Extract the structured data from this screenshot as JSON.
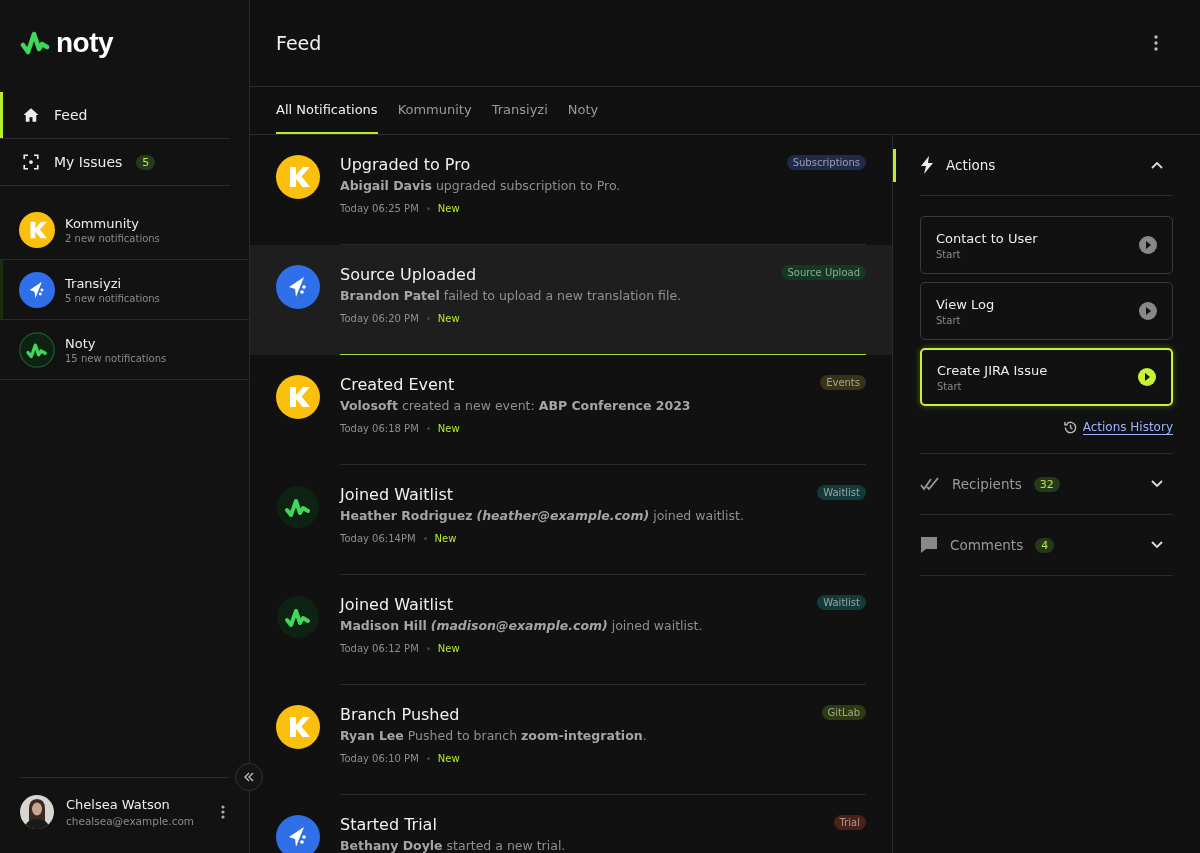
{
  "brand": {
    "name": "noty"
  },
  "nav": [
    {
      "kind": "home",
      "label": "Feed",
      "selected": true
    },
    {
      "kind": "issues",
      "label": "My Issues",
      "badge": "5",
      "selected": false
    }
  ],
  "workspaces": [
    {
      "kind": "k",
      "name": "Kommunity",
      "subtitle": "2 new notifications",
      "selected": false
    },
    {
      "kind": "transiyzi",
      "name": "Transiyzi",
      "subtitle": "5 new notifications",
      "selected": true
    },
    {
      "kind": "noty",
      "name": "Noty",
      "subtitle": "15 new notifications",
      "selected": false
    }
  ],
  "user": {
    "name": "Chelsea Watson",
    "email": "chealsea@example.com"
  },
  "header": {
    "title": "Feed"
  },
  "tabs": [
    {
      "label": "All Notifications",
      "selected": true
    },
    {
      "label": "Kommunity",
      "selected": false
    },
    {
      "label": "Transiyzi",
      "selected": false
    },
    {
      "label": "Noty",
      "selected": false
    }
  ],
  "notifications": [
    {
      "kind": "k",
      "title": "Upgraded to Pro",
      "message": "**Abigail Davis** upgraded subscription to Pro.",
      "time": "Today 06:25 PM",
      "status": "New",
      "tag": "Subscriptions",
      "color": "#1f2a4a",
      "selected": false
    },
    {
      "kind": "transiyzi",
      "title": "Source Uploaded",
      "message": "**Brandon Patel** failed to upload a new translation file.",
      "time": "Today 06:20 PM",
      "status": "New",
      "tag": "Source Upload",
      "color": "#123826",
      "selected": true
    },
    {
      "kind": "k",
      "title": "Created Event",
      "message": "**Volosoft** created a new event: **ABP Conference 2023**",
      "time": "Today 06:18 PM",
      "status": "New",
      "tag": "Events",
      "color": "#3a3216",
      "selected": false
    },
    {
      "kind": "noty",
      "title": "Joined Waitlist",
      "message": "**Heather Rodriguez** *(heather@example.com)* joined waitlist.",
      "time": "Today 06:14PM",
      "status": "New",
      "tag": "Waitlist",
      "color": "#123a38",
      "selected": false
    },
    {
      "kind": "noty",
      "title": "Joined Waitlist",
      "message": "**Madison Hill**  *(madison@example.com)* joined waitlist.",
      "time": "Today 06:12 PM",
      "status": "New",
      "tag": "Waitlist",
      "color": "#123a38",
      "selected": false
    },
    {
      "kind": "k",
      "title": "Branch Pushed",
      "message": "**Ryan Lee** Pushed to branch **zoom-integration**.",
      "time": "Today 06:10 PM",
      "status": "New",
      "tag": "GitLab",
      "color": "#2e3a12",
      "selected": false
    },
    {
      "kind": "transiyzi",
      "title": "Started Trial",
      "message": "**Bethany Doyle** started a new trial.",
      "tag": "Trial",
      "color": "#4a2018",
      "selected": false
    }
  ],
  "panel": {
    "sections": [
      {
        "kind": "actions",
        "title": "Actions",
        "expanded": true,
        "actions": [
          {
            "title": "Contact to User",
            "subtitle": "Start",
            "selected": false
          },
          {
            "title": "View Log",
            "subtitle": "Start",
            "selected": false
          },
          {
            "title": "Create JIRA Issue",
            "subtitle": "Start",
            "selected": true
          }
        ],
        "link": "Actions History"
      },
      {
        "kind": "recipients",
        "title": "Recipients",
        "badge": "32",
        "expanded": false
      },
      {
        "kind": "comments",
        "title": "Comments",
        "badge": "4",
        "expanded": false
      }
    ]
  }
}
